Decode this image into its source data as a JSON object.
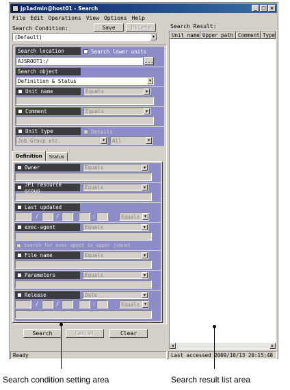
{
  "window": {
    "title": "jp1admin@host01 - Search",
    "minimize": "_",
    "maximize": "□",
    "close": "×"
  },
  "menu": [
    "File",
    "Edit",
    "Operations",
    "View",
    "Options",
    "Help"
  ],
  "search_condition": {
    "label": "Search Condition:",
    "save_label": "Save",
    "delete_label": "Delete",
    "value": "(Default)"
  },
  "search_location": {
    "label": "Search location",
    "lower_units_label": "Search lower units",
    "value": "AJSROOT1:/",
    "browse_label": "..."
  },
  "search_object": {
    "label": "Search object",
    "value": "Definition & Status"
  },
  "unit_name": {
    "label": "Unit name",
    "match": "Equals"
  },
  "comment": {
    "label": "Comment",
    "match": "Equals"
  },
  "unit_type": {
    "label": "Unit type",
    "details_label": "Details",
    "type_value": "Job Group etc.",
    "all_value": "All"
  },
  "tabs": [
    "Definition",
    "Status"
  ],
  "definition": {
    "owner": {
      "label": "Owner",
      "match": "Equals"
    },
    "jp1_resource_group": {
      "label": "JP1 resource group",
      "match": "Equals"
    },
    "last_updated": {
      "label": "Last updated",
      "slash1": "/",
      "slash2": "/",
      "colon": ":",
      "match": "Equals"
    },
    "exec_agent": {
      "label": "exec-agent",
      "match": "Equals",
      "upper_jobnet_label": "Search for exec-agent in upper jobnet"
    },
    "file_name": {
      "label": "File name",
      "match": "Equals"
    },
    "parameters": {
      "label": "Parameters",
      "match": "Equals"
    },
    "release": {
      "label": "Release",
      "date_value": "Date",
      "slash1": "/",
      "slash2": "/",
      "colon": ":",
      "match": "Equals"
    }
  },
  "buttons": {
    "search": "Search",
    "cancel": "Cancel",
    "clear": "Clear"
  },
  "search_result": {
    "label": "Search Result:",
    "columns": [
      "Unit name",
      "Upper path",
      "Comment",
      "Type"
    ]
  },
  "statusbar": {
    "left": "Ready",
    "right": "Last accessed 2009/10/13 20:15:48"
  },
  "callouts": {
    "left": "Search condition setting area",
    "right": "Search result list area"
  }
}
